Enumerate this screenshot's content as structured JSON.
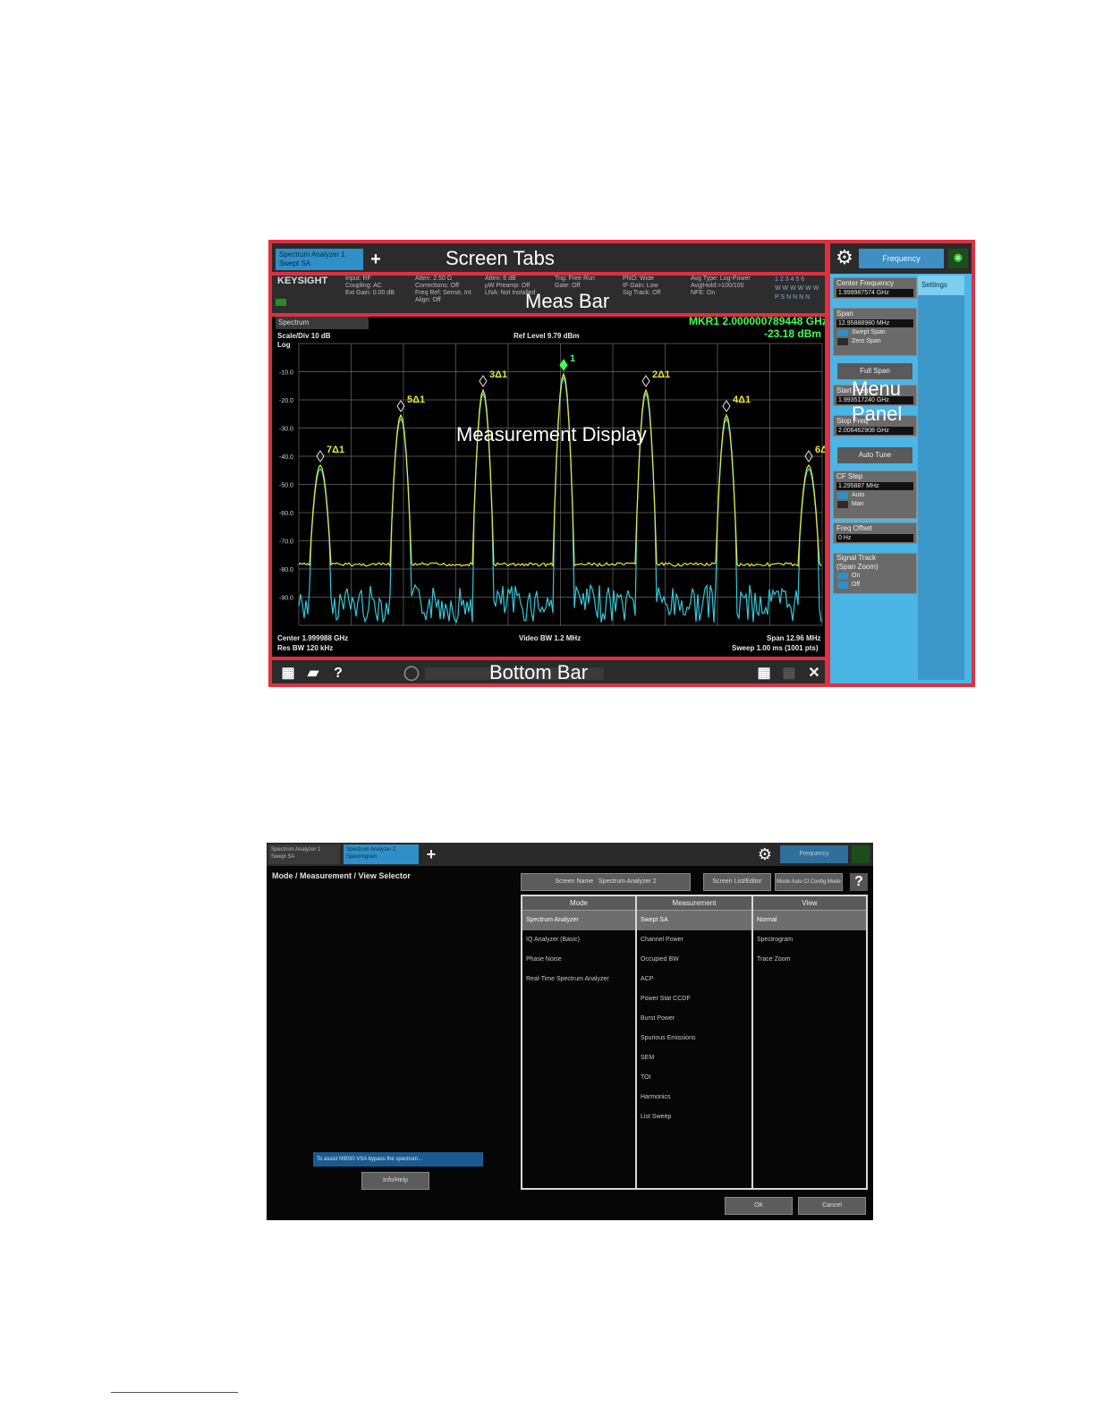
{
  "top_screenshot": {
    "screen_tab": {
      "line1": "Spectrum Analyzer 1",
      "line2": "Swept SA"
    },
    "add_tab": "+",
    "meas_bar": {
      "logo": "KEYSIGHT",
      "col1": "Input: RF\nCoupling: AC\nExt Gain: 0.00 dB",
      "col2": "Atten: 2.50 Ω\nCorrections: Off\nFreq Ref: Sense, Int\nAlign: Off",
      "col3": "Atten: 6 dB\nμW Preamp: Off\nLNA: Not Installed",
      "col4": "Trig: Free Run\nGate: Off",
      "col5": "PNO: Wide\nIF Gain: Low\nSig Track: Off",
      "col6": "Avg Type: Log-Power\nAvg|Hold:>100/100\nNFE: On",
      "trace_grid": "1 2 3 4 5 6\nW W W W W W\nP S N N N N"
    },
    "display": {
      "view_selector": "Spectrum",
      "scale": "Scale/Div 10 dB",
      "log": "Log",
      "ref_level": "Ref Level 9.79 dBm",
      "marker_freq": "MKR1 2.000000789448 GHz",
      "marker_amp": "-23.18 dBm",
      "y_ticks": [
        "-10.0",
        "-20.0",
        "-30.0",
        "-40.0",
        "-50.0",
        "-60.0",
        "-70.0",
        "-80.0",
        "-90.0"
      ],
      "center": "Center 1.999988 GHz",
      "res_bw": "Res BW 120 kHz",
      "video_bw": "Video BW 1.2 MHz",
      "span": "Span 12.96 MHz",
      "sweep": "Sweep 1.00 ms (1001 pts)",
      "marker_labels": [
        "7Δ1",
        "5Δ1",
        "3Δ1",
        "1",
        "2Δ1",
        "4Δ1",
        "6Δ1"
      ]
    },
    "bottom_bar": {
      "windows_icon": "▦",
      "folder_icon": "▰",
      "help": "?",
      "chat_icon": "◯",
      "layout_icon": "▦",
      "maximize_icon": "✕"
    },
    "menu_panel": {
      "gear": "⚙",
      "selector": "Frequency",
      "sun_icon": "✺",
      "tab": "Settings",
      "center_freq_label": "Center Frequency",
      "center_freq_value": "1.999987574 GHz",
      "span_label": "Span",
      "span_value": "12.95888980 MHz",
      "swept_span": "Swept Span",
      "zero_span": "Zero Span",
      "full_span": "Full Span",
      "start_freq_label": "Start Freq",
      "start_freq_value": "1.993517240 GHz",
      "stop_freq_label": "Stop Freq",
      "stop_freq_value": "2.006462908 GHz",
      "auto_tune": "Auto Tune",
      "cf_step_label": "CF Step",
      "cf_step_value": "1.295887 MHz",
      "auto": "Auto",
      "man": "Man",
      "freq_offset_label": "Freq Offset",
      "freq_offset_value": "0 Hz",
      "signal_track_label": "Signal Track",
      "signal_track_sub": "(Span Zoom)",
      "on": "On",
      "off": "Off"
    },
    "annotations": {
      "screen_tabs": "Screen Tabs",
      "meas_bar": "Meas Bar",
      "measurement_display": "Measurement Display",
      "menu": "Menu",
      "panel": "Panel",
      "bottom_bar": "Bottom Bar"
    },
    "colors": {
      "annotation": "#e03040",
      "trace_yellow": "#e6e83a",
      "trace_cyan": "#33c8d8",
      "marker_green": "#3dff55",
      "panel_blue": "#4bb5e6"
    }
  },
  "bottom_screenshot": {
    "tabs": [
      {
        "line1": "Spectrum Analyzer 1",
        "line2": "Swept SA"
      },
      {
        "line1": "Spectrum Analyzer 2",
        "line2": "Spectrogram"
      }
    ],
    "add_tab": "+",
    "gear": "⚙",
    "selector": "Frequency",
    "title": "Mode / Measurement / View Selector",
    "buttons": {
      "screen_name": "Screen Name",
      "name_value": "Spectrum Analyzer 2",
      "screen_list": "Screen List/Editor",
      "mode_auto": "Mode Auto Cl Config Mode"
    },
    "help": "?",
    "columns": {
      "mode": {
        "header": "Mode",
        "items": [
          "Spectrum Analyzer",
          "IQ Analyzer (Basic)",
          "Phase Noise",
          "Real-Time Spectrum Analyzer"
        ]
      },
      "measurement": {
        "header": "Measurement",
        "items": [
          "Swept SA",
          "Channel Power",
          "Occupied BW",
          "ACP",
          "Power Stat CCDF",
          "Burst Power",
          "Spurious Emissions",
          "SEM",
          "TOI",
          "Harmonics",
          "List Sweep"
        ]
      },
      "view": {
        "header": "View",
        "items": [
          "Normal",
          "Spectrogram",
          "Trace Zoom"
        ]
      }
    },
    "info": "To assist N9030 VSA bypass the spectrum...",
    "info_button": "Info/Help",
    "ok": "OK",
    "cancel": "Cancel"
  }
}
